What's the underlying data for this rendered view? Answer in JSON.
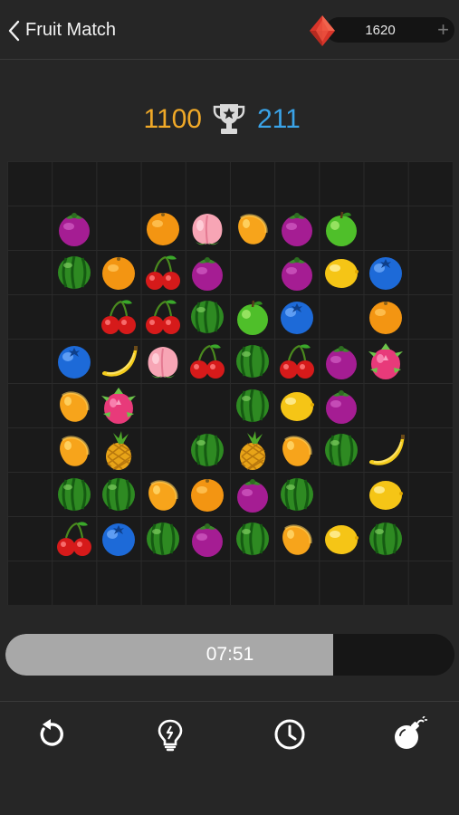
{
  "header": {
    "title": "Fruit Match",
    "gems": "1620",
    "plus": "+"
  },
  "scores": {
    "current": "1100",
    "best": "211"
  },
  "timer": {
    "text": "07:51",
    "progress": 0.73
  },
  "board": {
    "columns": 10,
    "rows": 10,
    "cells": [
      [
        "",
        "",
        "",
        "",
        "",
        "",
        "",
        "",
        "",
        ""
      ],
      [
        "",
        "mangosteen",
        "",
        "orange",
        "peach",
        "mango",
        "mangosteen",
        "apple",
        "",
        ""
      ],
      [
        "",
        "watermelon",
        "orange",
        "cherry",
        "mangosteen",
        "",
        "mangosteen",
        "lemon",
        "blueberry",
        ""
      ],
      [
        "",
        "",
        "cherry",
        "cherry",
        "watermelon",
        "apple",
        "blueberry",
        "",
        "orange",
        ""
      ],
      [
        "",
        "blueberry",
        "banana",
        "peach",
        "cherry",
        "watermelon",
        "cherry",
        "mangosteen",
        "dragonfruit",
        ""
      ],
      [
        "",
        "mango",
        "dragonfruit",
        "",
        "",
        "watermelon",
        "lemon",
        "mangosteen",
        "",
        ""
      ],
      [
        "",
        "mango",
        "pineapple",
        "",
        "watermelon",
        "pineapple",
        "mango",
        "watermelon",
        "banana",
        ""
      ],
      [
        "",
        "watermelon",
        "watermelon",
        "mango",
        "orange",
        "mangosteen",
        "watermelon",
        "",
        "lemon",
        ""
      ],
      [
        "",
        "cherry",
        "blueberry",
        "watermelon",
        "mangosteen",
        "watermelon",
        "mango",
        "lemon",
        "watermelon",
        ""
      ],
      [
        "",
        "",
        "",
        "",
        "",
        "",
        "",
        "",
        "",
        ""
      ]
    ]
  },
  "toolbar": {
    "items": [
      {
        "name": "restart",
        "icon": "restart-icon"
      },
      {
        "name": "hint",
        "icon": "lightbulb-icon"
      },
      {
        "name": "time",
        "icon": "clock-icon"
      },
      {
        "name": "bomb",
        "icon": "bomb-icon"
      }
    ]
  },
  "colors": {
    "score_current": "#f0a928",
    "score_best": "#3aa3e8",
    "gem": "#e8463a"
  }
}
